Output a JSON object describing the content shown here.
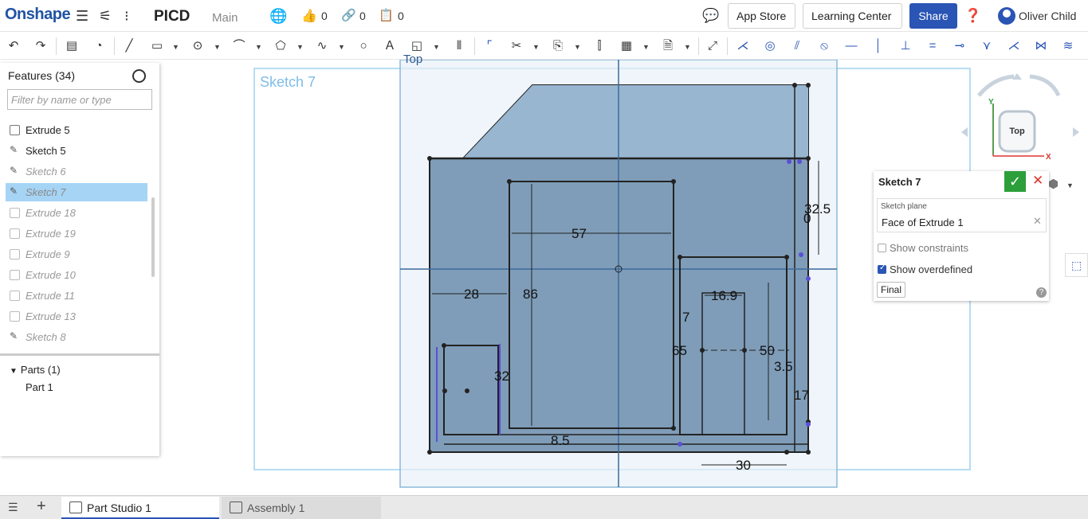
{
  "topbar": {
    "logo": "Onshape",
    "doc_title": "PICD",
    "branch": "Main",
    "likes": "0",
    "links": "0",
    "copies": "0",
    "app_store": "App Store",
    "learning_center": "Learning Center",
    "share": "Share",
    "user_name": "Oliver Child"
  },
  "features_panel": {
    "title": "Features (34)",
    "filter_placeholder": "Filter by name or type",
    "items": [
      {
        "label": "Extrude 5",
        "kind": "extrude",
        "state": "normal"
      },
      {
        "label": "Sketch 5",
        "kind": "sketch",
        "state": "normal"
      },
      {
        "label": "Sketch 6",
        "kind": "sketch",
        "state": "dim"
      },
      {
        "label": "Sketch 7",
        "kind": "sketch",
        "state": "selected"
      },
      {
        "label": "Extrude 18",
        "kind": "extrude",
        "state": "dim"
      },
      {
        "label": "Extrude 19",
        "kind": "extrude",
        "state": "dim"
      },
      {
        "label": "Extrude 9",
        "kind": "extrude",
        "state": "dim"
      },
      {
        "label": "Extrude 10",
        "kind": "extrude",
        "state": "dim"
      },
      {
        "label": "Extrude 11",
        "kind": "extrude",
        "state": "dim"
      },
      {
        "label": "Extrude 13",
        "kind": "extrude",
        "state": "dim"
      },
      {
        "label": "Sketch 8",
        "kind": "sketch",
        "state": "dim"
      }
    ],
    "parts_header": "Parts (1)",
    "part_item": "Part 1"
  },
  "canvas": {
    "sketch_name": "Sketch 7",
    "view_name": "Top",
    "dimensions": [
      "57",
      "86",
      "28",
      "32.5",
      "65",
      "50",
      "16.9",
      "30",
      "32",
      "3.5",
      "17",
      "8.5",
      "0",
      "7"
    ]
  },
  "viewcube": {
    "face_label": "Top",
    "axis_y": "Y",
    "axis_x": "X"
  },
  "sketch_dialog": {
    "title": "Sketch 7",
    "plane_label": "Sketch plane",
    "plane_value": "Face of Extrude 1",
    "show_constraints": "Show constraints",
    "show_constraints_checked": false,
    "show_overdefined": "Show overdefined",
    "show_overdefined_checked": true,
    "final": "Final"
  },
  "tabs": [
    {
      "label": "Part Studio 1",
      "active": true
    },
    {
      "label": "Assembly 1",
      "active": false
    }
  ],
  "colors": {
    "brand": "#2153a3",
    "share": "#2a55b5",
    "ok": "#2c9e3a",
    "sketch_fill": "#8eaac4",
    "selection": "#a6d4f5"
  }
}
